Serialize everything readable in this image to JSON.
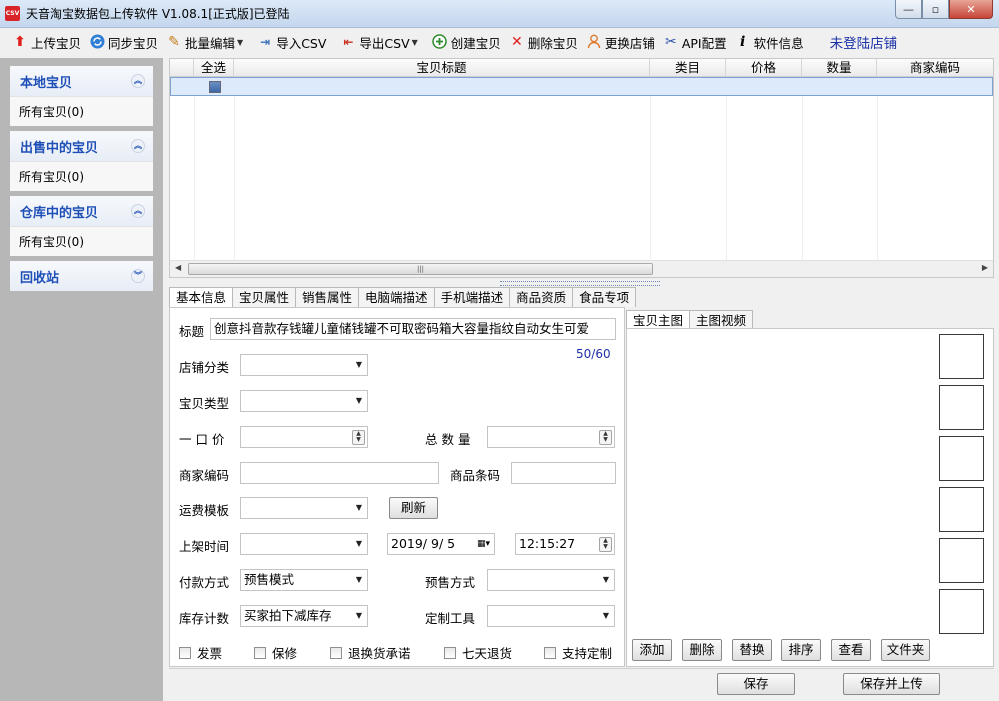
{
  "window": {
    "title": "天音淘宝数据包上传软件 V1.08.1[正式版]已登陆",
    "app_icon_text": "CSV",
    "buttons": {
      "minimize": "—",
      "maximize": "▫",
      "close": "✕"
    }
  },
  "toolbar": {
    "items": [
      {
        "label": "上传宝贝",
        "icon": "upload-arrow-icon"
      },
      {
        "label": "同步宝贝",
        "icon": "sync-icon"
      },
      {
        "label": "批量编辑",
        "icon": "pencil-icon"
      },
      {
        "label": "导入CSV",
        "icon": "import-icon"
      },
      {
        "label": "导出CSV",
        "icon": "export-icon"
      },
      {
        "label": "创建宝贝",
        "icon": "plus-circle-icon"
      },
      {
        "label": "删除宝贝",
        "icon": "x-icon"
      },
      {
        "label": "更换店铺",
        "icon": "user-icon"
      },
      {
        "label": "API配置",
        "icon": "tools-icon"
      },
      {
        "label": "软件信息",
        "icon": "info-icon"
      }
    ],
    "login_status": "未登陆店铺"
  },
  "sidebar": {
    "groups": [
      {
        "title": "本地宝贝",
        "item": "所有宝贝(0)"
      },
      {
        "title": "出售中的宝贝",
        "item": "所有宝贝(0)"
      },
      {
        "title": "仓库中的宝贝",
        "item": "所有宝贝(0)"
      },
      {
        "title": "回收站"
      }
    ]
  },
  "table": {
    "columns": [
      "全选",
      "宝贝标题",
      "类目",
      "价格",
      "数量",
      "商家编码"
    ]
  },
  "tabs": [
    "基本信息",
    "宝贝属性",
    "销售属性",
    "电脑端描述",
    "手机端描述",
    "商品资质",
    "食品专项"
  ],
  "form": {
    "title_label": "标题",
    "title_value": "创意抖音款存钱罐儿童储钱罐不可取密码箱大容量指纹自动女生可爱",
    "title_counter": "50/60",
    "shop_category_label": "店铺分类",
    "item_type_label": "宝贝类型",
    "price_label": "一 口 价",
    "total_qty_label": "总 数 量",
    "merchant_code_label": "商家编码",
    "barcode_label": "商品条码",
    "shipping_template_label": "运费模板",
    "refresh_button": "刷新",
    "listing_time_label": "上架时间",
    "listing_date": "2019/ 9/ 5",
    "listing_clock": "12:15:27",
    "payment_label": "付款方式",
    "payment_value": "预售模式",
    "presale_label": "预售方式",
    "stock_label": "库存计数",
    "stock_value": "买家拍下减库存",
    "custom_tool_label": "定制工具",
    "checkboxes": [
      "发票",
      "保修",
      "退换货承诺",
      "七天退货",
      "支持定制"
    ]
  },
  "image_panel": {
    "tabs": [
      "宝贝主图",
      "主图视频"
    ],
    "buttons": [
      "添加",
      "删除",
      "替换",
      "排序",
      "查看",
      "文件夹"
    ]
  },
  "bottom": {
    "save": "保存",
    "save_upload": "保存并上传"
  }
}
